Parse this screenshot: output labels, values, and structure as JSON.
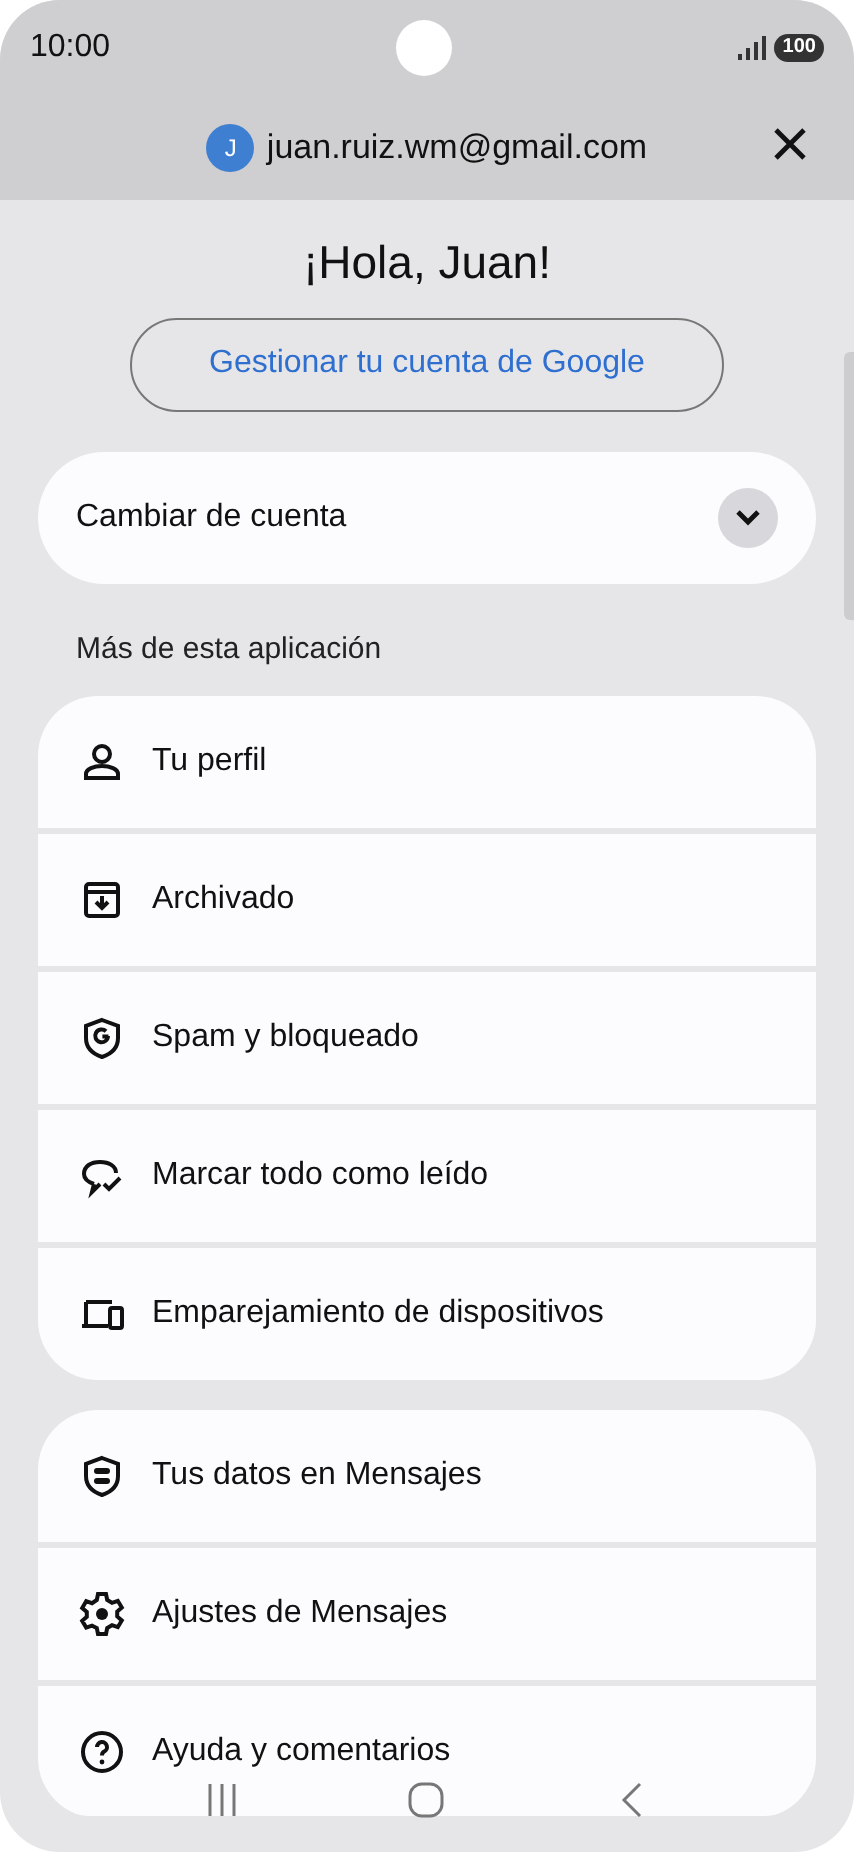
{
  "status_bar": {
    "time": "10:00",
    "battery": "100"
  },
  "header": {
    "avatar_letter": "J",
    "email": "juan.ruiz.wm@gmail.com"
  },
  "greeting": "¡Hola, Juan!",
  "manage_button": "Gestionar tu cuenta de Google",
  "switch_account": {
    "label": "Cambiar de cuenta",
    "expanded": false
  },
  "section_label": "Más de esta aplicación",
  "groups": [
    {
      "items": [
        {
          "label": "Tu perfil"
        },
        {
          "label": "Archivado"
        },
        {
          "label": "Spam y bloqueado"
        },
        {
          "label": "Marcar todo como leído"
        },
        {
          "label": "Emparejamiento de dispositivos"
        }
      ]
    },
    {
      "items": [
        {
          "label": "Tus datos en Mensajes"
        },
        {
          "label": "Ajustes de Mensajes"
        },
        {
          "label": "Ayuda y comentarios"
        }
      ]
    }
  ]
}
